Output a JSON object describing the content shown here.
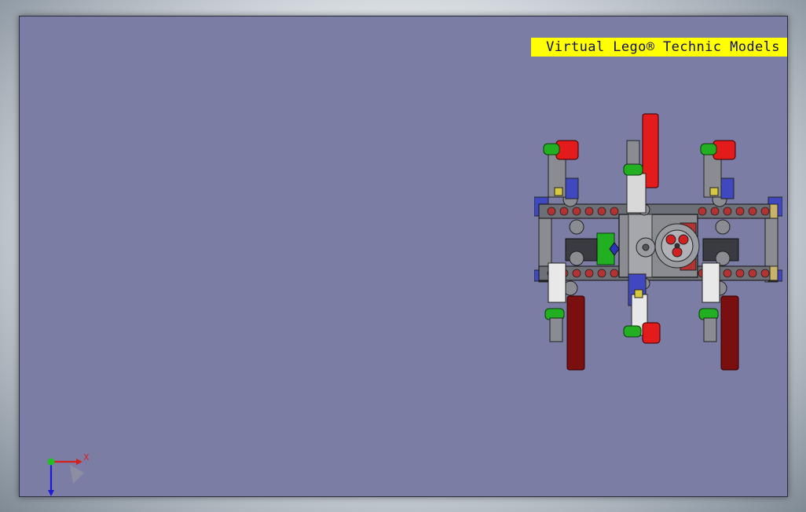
{
  "banner": {
    "text": "Virtual Lego® Technic Models"
  },
  "triad": {
    "x_label": "X"
  },
  "colors": {
    "viewport_bg": "#7b7da5",
    "banner_bg": "#ffff00",
    "banner_text": "#101050",
    "brick_red": "#e31b1b",
    "dark_red": "#7a0f0f",
    "green": "#22b022",
    "blue": "#2b35b8",
    "gray": "#8a8c92",
    "white": "#e8e8e8",
    "tan": "#c9b36a"
  },
  "icons": [
    "x-axis-arrow-icon",
    "y-axis-arrow-icon",
    "origin-point-icon"
  ]
}
